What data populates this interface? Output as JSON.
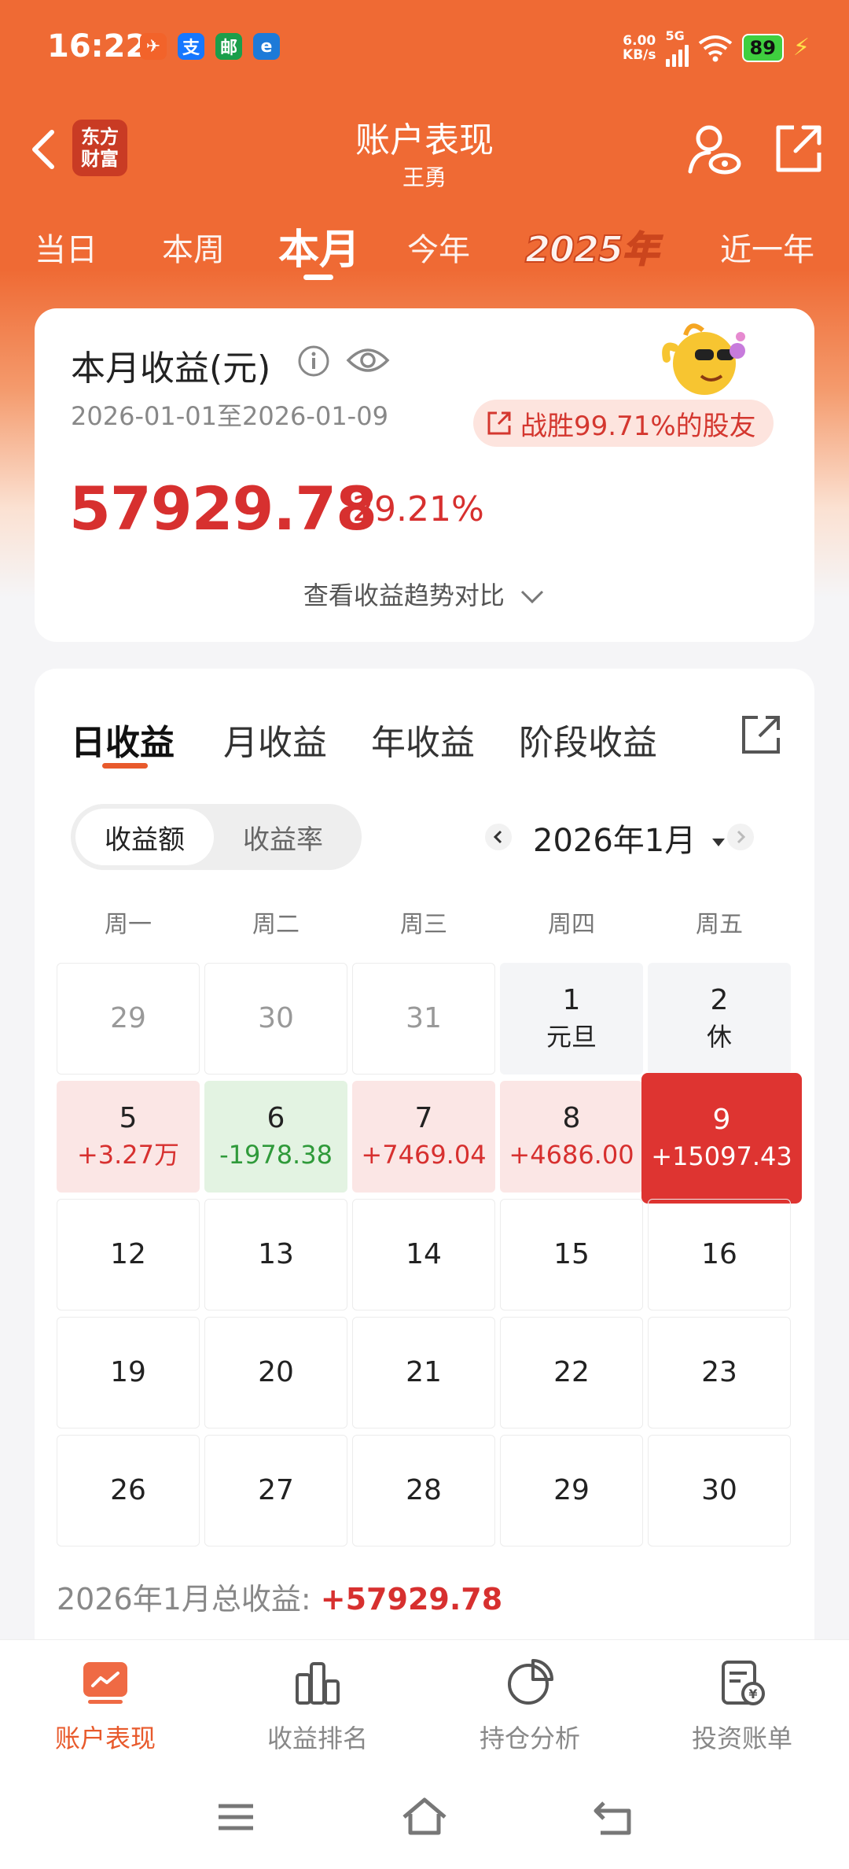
{
  "status_bar": {
    "time": "16:22",
    "net_speed_value": "6.00",
    "net_speed_unit": "KB/s",
    "network_type": "5G",
    "battery": "89",
    "app_icons": [
      {
        "name": "message-app-icon",
        "glyph": "✈",
        "color": "#f2632a"
      },
      {
        "name": "alipay-app-icon",
        "glyph": "支",
        "color": "#1677ff"
      },
      {
        "name": "postal-app-icon",
        "glyph": "邮",
        "color": "#1a9e4b"
      },
      {
        "name": "telecom-app-icon",
        "glyph": "e",
        "color": "#1d7ad8"
      }
    ]
  },
  "header": {
    "logo_text_line1": "东方",
    "logo_text_line2": "财富",
    "title": "账户表现",
    "subtitle": "王勇"
  },
  "period_tabs": [
    {
      "label": "当日",
      "active": false
    },
    {
      "label": "本周",
      "active": false
    },
    {
      "label": "本月",
      "active": true
    },
    {
      "label": "今年",
      "active": false
    },
    {
      "label": "2025年",
      "active": false
    },
    {
      "label": "近一年",
      "active": false
    }
  ],
  "summary": {
    "title": "本月收益(元)",
    "date_range": "2026-01-01至2026-01-09",
    "beat_text": "战胜99.71%的股友",
    "value": "57929.78",
    "percent": "29.21%",
    "trend_link": "查看收益趋势对比"
  },
  "calendar": {
    "tabs": [
      {
        "label": "日收益",
        "active": true
      },
      {
        "label": "月收益",
        "active": false
      },
      {
        "label": "年收益",
        "active": false
      },
      {
        "label": "阶段收益",
        "active": false
      }
    ],
    "toggle": {
      "on": "收益额",
      "off": "收益率"
    },
    "month_label": "2026年1月",
    "weekdays": [
      "周一",
      "周二",
      "周三",
      "周四",
      "周五"
    ],
    "rows": [
      [
        {
          "day": "29",
          "sub": "",
          "type": "other"
        },
        {
          "day": "30",
          "sub": "",
          "type": "other"
        },
        {
          "day": "31",
          "sub": "",
          "type": "other"
        },
        {
          "day": "1",
          "sub": "元旦",
          "type": "holiday"
        },
        {
          "day": "2",
          "sub": "休",
          "type": "holiday"
        }
      ],
      [
        {
          "day": "5",
          "sub": "+3.27万",
          "type": "gain"
        },
        {
          "day": "6",
          "sub": "-1978.38",
          "type": "loss"
        },
        {
          "day": "7",
          "sub": "+7469.04",
          "type": "gain"
        },
        {
          "day": "8",
          "sub": "+4686.00",
          "type": "gain"
        },
        {
          "day": "9",
          "sub": "+15097.43",
          "type": "today"
        }
      ],
      [
        {
          "day": "12",
          "sub": "",
          "type": "normal"
        },
        {
          "day": "13",
          "sub": "",
          "type": "normal"
        },
        {
          "day": "14",
          "sub": "",
          "type": "normal"
        },
        {
          "day": "15",
          "sub": "",
          "type": "normal"
        },
        {
          "day": "16",
          "sub": "",
          "type": "normal"
        }
      ],
      [
        {
          "day": "19",
          "sub": "",
          "type": "normal"
        },
        {
          "day": "20",
          "sub": "",
          "type": "normal"
        },
        {
          "day": "21",
          "sub": "",
          "type": "normal"
        },
        {
          "day": "22",
          "sub": "",
          "type": "normal"
        },
        {
          "day": "23",
          "sub": "",
          "type": "normal"
        }
      ],
      [
        {
          "day": "26",
          "sub": "",
          "type": "normal"
        },
        {
          "day": "27",
          "sub": "",
          "type": "normal"
        },
        {
          "day": "28",
          "sub": "",
          "type": "normal"
        },
        {
          "day": "29",
          "sub": "",
          "type": "normal"
        },
        {
          "day": "30",
          "sub": "",
          "type": "normal"
        }
      ]
    ],
    "total_label": "2026年1月总收益: ",
    "total_value": "+57929.78"
  },
  "bottom_nav": [
    {
      "label": "账户表现",
      "icon": "account-performance-icon",
      "active": true
    },
    {
      "label": "收益排名",
      "icon": "ranking-bar-icon",
      "active": false
    },
    {
      "label": "持仓分析",
      "icon": "pie-chart-icon",
      "active": false
    },
    {
      "label": "投资账单",
      "icon": "bill-icon",
      "active": false
    }
  ],
  "colors": {
    "brand": "#ef6a34",
    "gain": "#d7302f",
    "loss": "#2f9a3a",
    "accent": "#e85a2c"
  }
}
